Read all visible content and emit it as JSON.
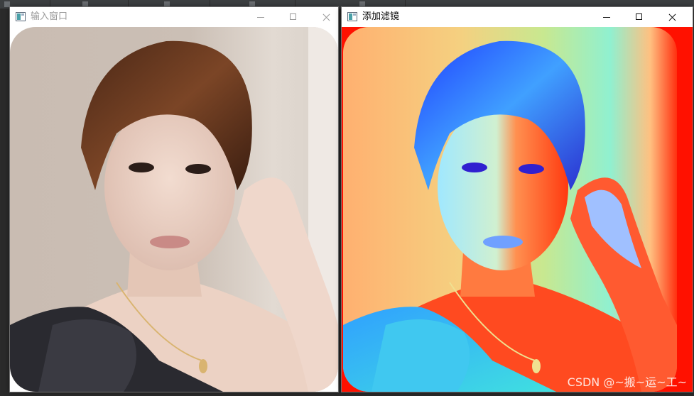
{
  "windows": {
    "input": {
      "title": "输入窗口"
    },
    "filter": {
      "title": "添加滤镜"
    }
  },
  "watermark": {
    "text": "CSDN @~搬~运~工~"
  },
  "icons": {
    "app": "opencv-window-icon",
    "minimize": "minimize-icon",
    "maximize": "maximize-icon",
    "close": "close-icon"
  },
  "colors": {
    "title_inactive": "#9a9a9a",
    "title_active": "#000000",
    "filter_background": "#ff1100"
  }
}
